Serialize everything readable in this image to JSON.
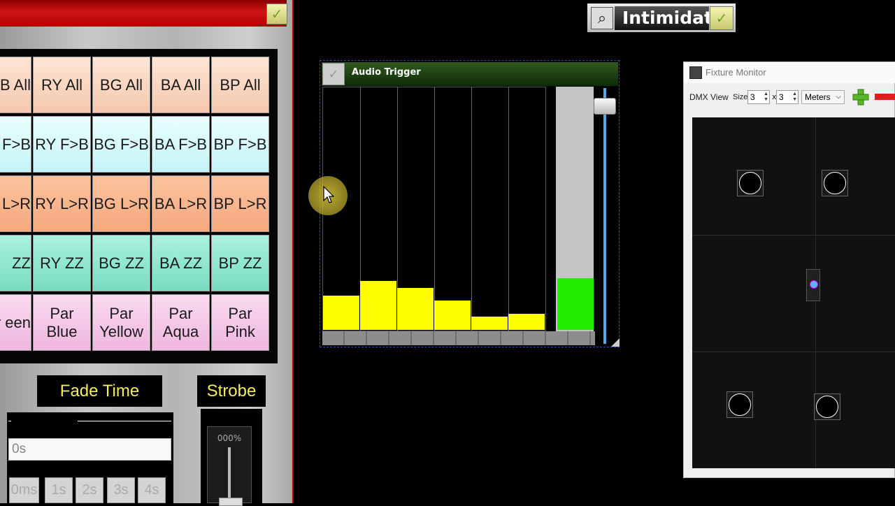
{
  "left_panel": {
    "grid": [
      [
        "B All",
        "RY All",
        "BG All",
        "BA All",
        "BP All"
      ],
      [
        "F>B",
        "RY F>B",
        "BG F>B",
        "BA F>B",
        "BP F>B"
      ],
      [
        "L>R",
        "RY L>R",
        "BG L>R",
        "BA L>R",
        "BP L>R"
      ],
      [
        "ZZ",
        "RY ZZ",
        "BG ZZ",
        "BA ZZ",
        "BP ZZ"
      ],
      [
        "Par een",
        "Par Blue",
        "Par Yellow",
        "Par Aqua",
        "Par Pink"
      ]
    ],
    "fade_time_label": "Fade Time",
    "fade_time_value": "0s",
    "time_presets": [
      "0ms",
      "1s",
      "2s",
      "3s",
      "4s"
    ],
    "strobe_label": "Strobe",
    "strobe_value": "000%"
  },
  "title_widget": {
    "text": "Intimidat",
    "icon": "search-icon"
  },
  "audio_trigger": {
    "title": "Audio Trigger",
    "bands": [
      0.14,
      0.2,
      0.17,
      0.12,
      0.055,
      0.065
    ],
    "volume_level": 0.21,
    "sensitivity_slider": 0.05,
    "colors": {
      "bar": "#ffff00",
      "level": "#22ee00"
    }
  },
  "fixture_monitor": {
    "title": "Fixture Monitor",
    "dmx_view_label": "DMX View",
    "size_label": "Size",
    "width_value": "3",
    "x_label": "x",
    "height_value": "3",
    "unit": "Meters"
  },
  "icons": {
    "check": "check-icon",
    "add": "plus-icon",
    "remove": "minus-icon"
  }
}
